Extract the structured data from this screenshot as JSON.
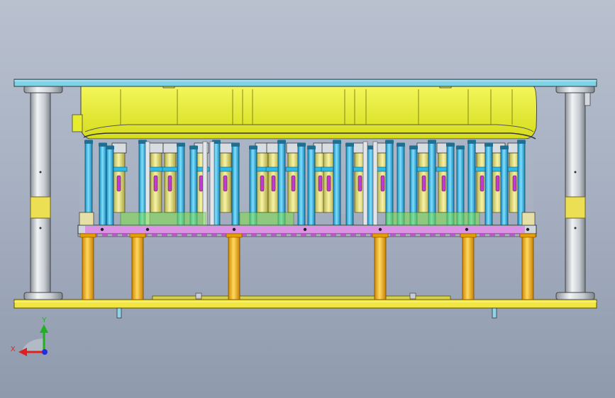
{
  "view": {
    "background_top": "#b9c1cf",
    "background_bottom": "#8f9aad"
  },
  "colors": {
    "top_plate": "#7fd3e6",
    "bottom_plate": "#f2e640",
    "upper_holder": "#e6ec2e",
    "guide_post": "#c9cdd3",
    "guide_band": "#ecdf54",
    "cyan_rod": "#2fb9e6",
    "yellow_barrel": "#e9e47a",
    "magenta_slot": "#c23bd0",
    "stripper_plate": "#cfd6dc",
    "green_insert": "#7fe04a",
    "support_pillar": "#f4b400"
  },
  "triad": {
    "x_label": "X",
    "y_label": "Y",
    "x_color": "#e02020",
    "y_color": "#20b020",
    "z_color": "#2030e0"
  }
}
